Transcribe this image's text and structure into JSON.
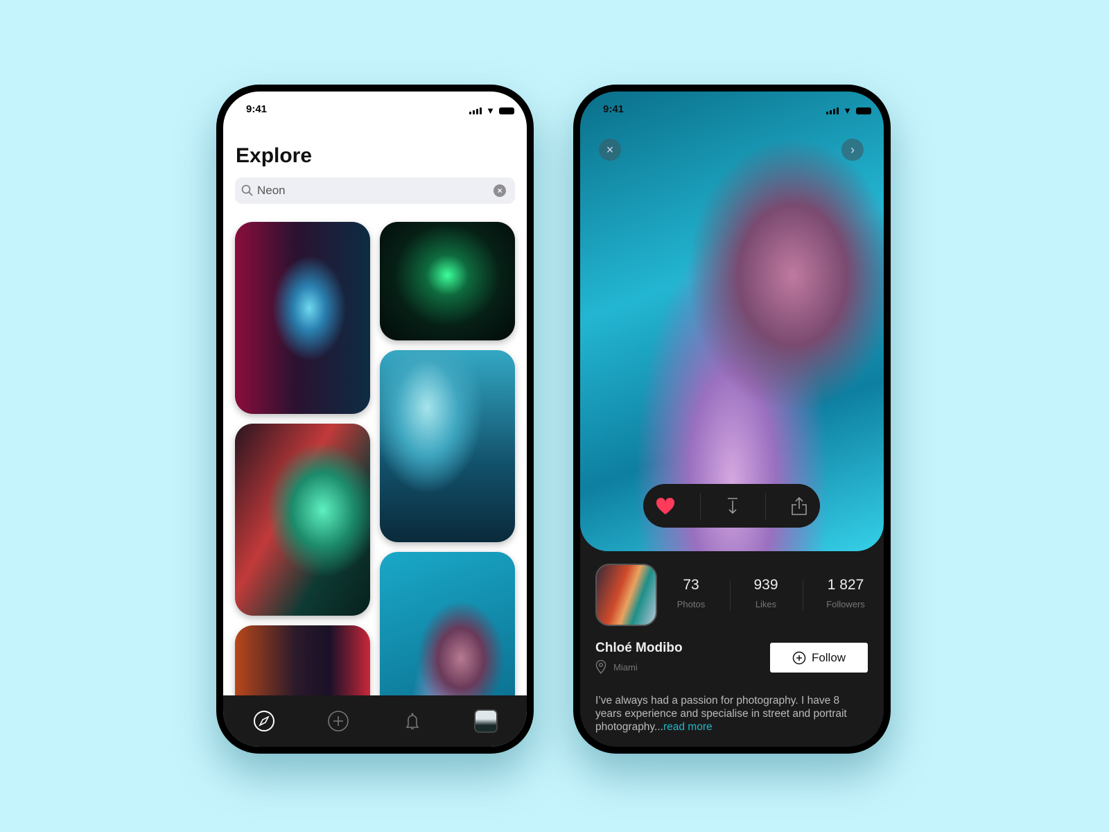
{
  "status": {
    "time": "9:41"
  },
  "explore": {
    "title": "Explore",
    "search": {
      "value": "Neon",
      "placeholder": "Search"
    },
    "tiles": [
      "neon-skyscraper",
      "neon-cactus",
      "green-smoke-woman",
      "smoke-man-jacket",
      "bubblegum-woman",
      "woman-lights"
    ],
    "nav": [
      {
        "icon": "compass-icon",
        "active": true
      },
      {
        "icon": "plus-circle-icon"
      },
      {
        "icon": "bell-icon"
      },
      {
        "icon": "profile-avatar"
      }
    ]
  },
  "detail": {
    "actions": {
      "like_color": "#ff3b5c"
    },
    "stats": [
      {
        "value": "73",
        "label": "Photos"
      },
      {
        "value": "939",
        "label": "Likes"
      },
      {
        "value": "1 827",
        "label": "Followers"
      }
    ],
    "name": "Chloé Modibo",
    "location": "Miami",
    "follow_label": "Follow",
    "bio": "I’ve always had a passion for photography. I have 8 years experience and specialise in street and portrait photography...",
    "read_more": "read more",
    "accent": "#1fb8c8"
  }
}
